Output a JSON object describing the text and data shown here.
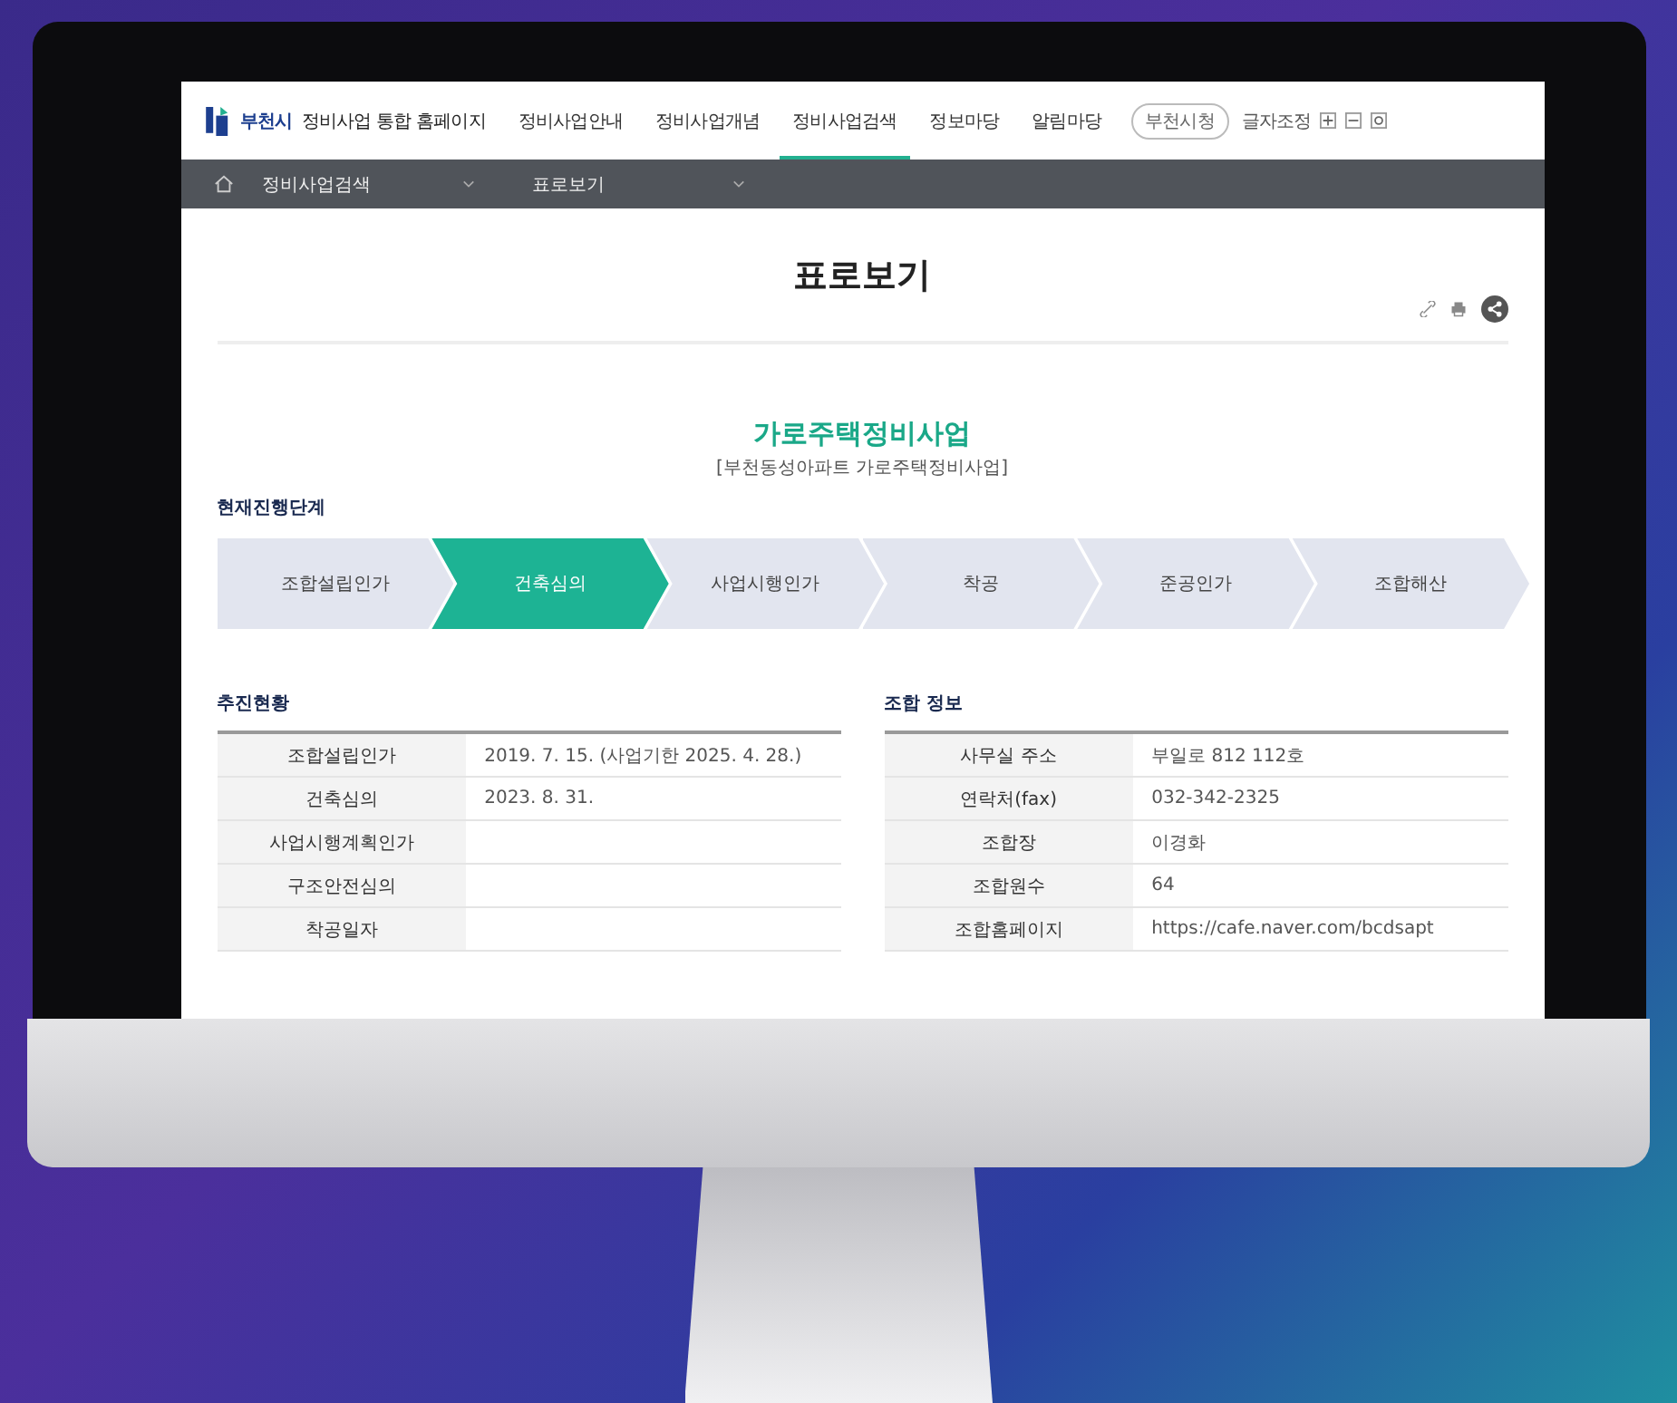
{
  "header": {
    "logo_text": "부천시",
    "site_title": "정비사업 통합 홈페이지",
    "nav": [
      {
        "label": "정비사업안내",
        "selected": false
      },
      {
        "label": "정비사업개념",
        "selected": false
      },
      {
        "label": "정비사업검색",
        "selected": true
      },
      {
        "label": "정보마당",
        "selected": false
      },
      {
        "label": "알림마당",
        "selected": false
      }
    ],
    "city_button": "부천시청",
    "font_size_label": "글자조정"
  },
  "breadcrumb": [
    "정비사업검색",
    "표로보기"
  ],
  "page_title": "표로보기",
  "project": {
    "title": "가로주택정비사업",
    "subtitle": "[부천동성아파트 가로주택정비사업]"
  },
  "stage_heading": "현재진행단계",
  "stages": [
    {
      "label": "조합설립인가",
      "selected": false
    },
    {
      "label": "건축심의",
      "selected": true
    },
    {
      "label": "사업시행인가",
      "selected": false
    },
    {
      "label": "착공",
      "selected": false
    },
    {
      "label": "준공인가",
      "selected": false
    },
    {
      "label": "조합해산",
      "selected": false
    }
  ],
  "progress": {
    "heading": "추진현황",
    "rows": [
      {
        "label": "조합설립인가",
        "value": "2019. 7. 15. (사업기한 2025. 4. 28.)"
      },
      {
        "label": "건축심의",
        "value": "2023. 8. 31."
      },
      {
        "label": "사업시행계획인가"
      },
      {
        "label": "구조안전심의"
      },
      {
        "label": "착공일자"
      }
    ]
  },
  "association": {
    "heading": "조합 정보",
    "rows": [
      {
        "label": "사무실 주소",
        "value": "부일로 812 112호"
      },
      {
        "label": "연락처(fax)",
        "value": "032-342-2325"
      },
      {
        "label": "조합장",
        "value": "이경화"
      },
      {
        "label": "조합원수",
        "value": "64"
      },
      {
        "label": "조합홈페이지",
        "value": "https://cafe.naver.com/bcdsapt"
      }
    ]
  }
}
